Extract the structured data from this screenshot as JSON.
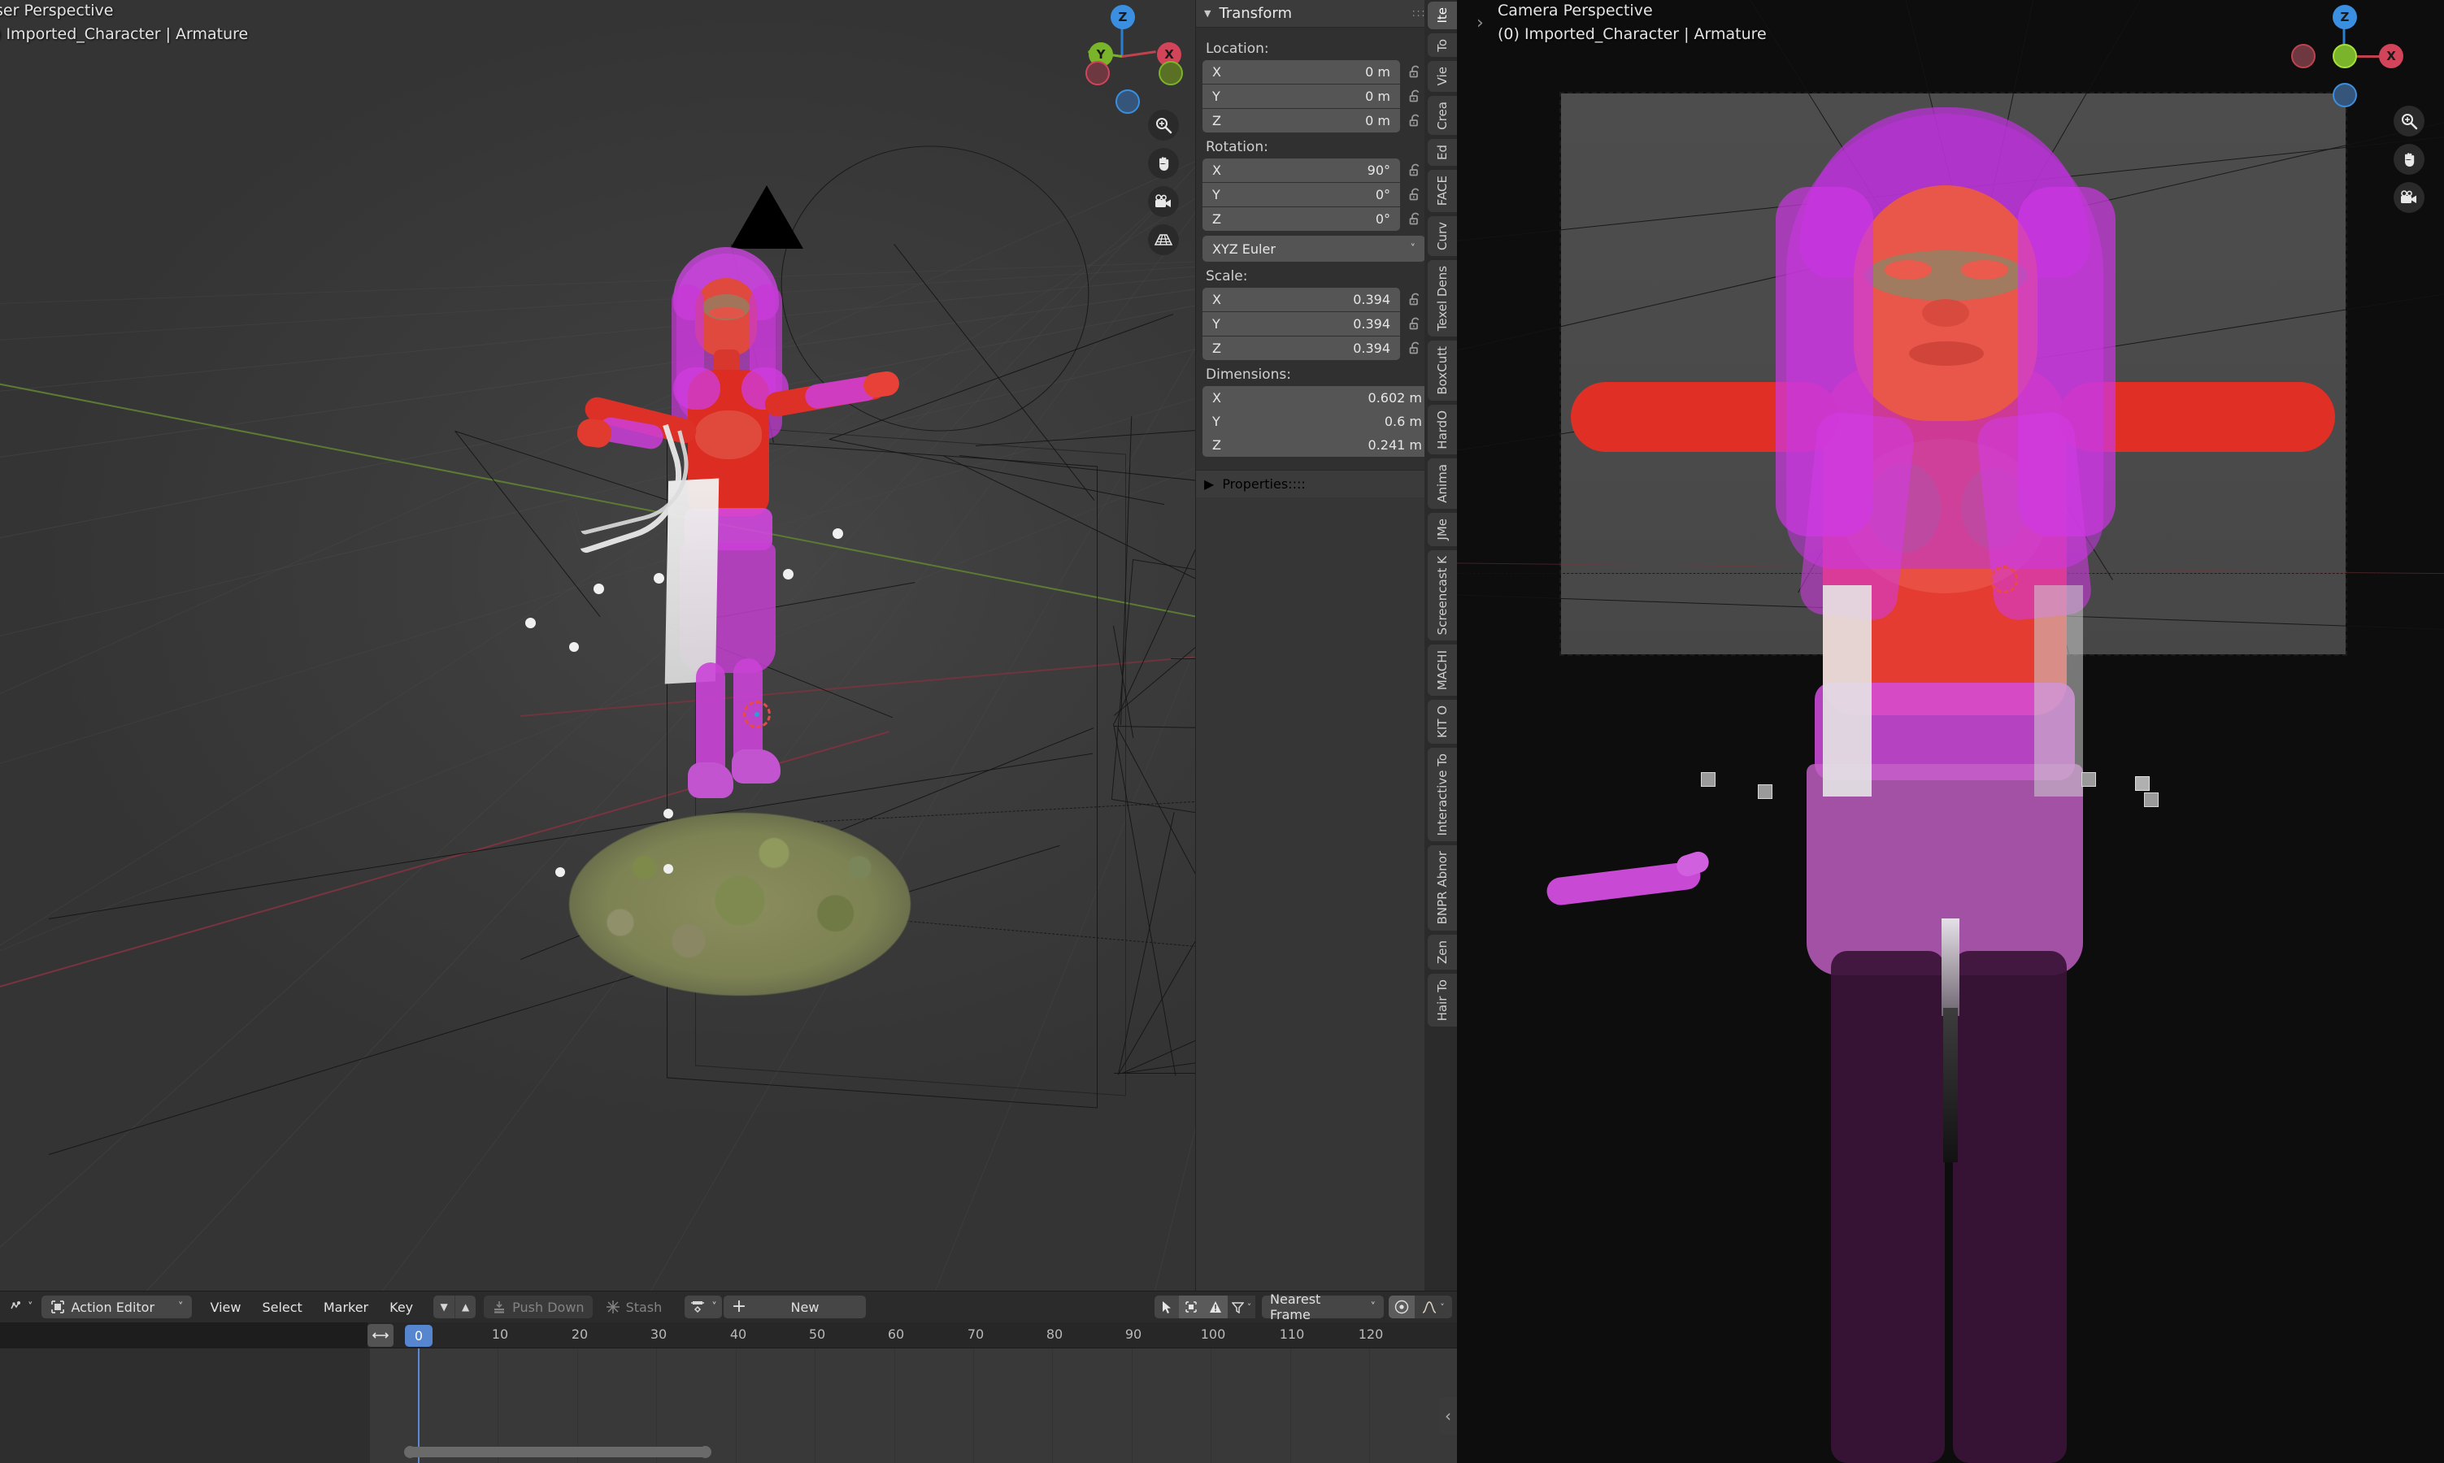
{
  "app": "blender",
  "left_viewport": {
    "name": "3d-viewport-user-perspective",
    "perspective_label": "ser Perspective",
    "object_label": ") Imported_Character | Armature",
    "gizmo": {
      "z": "Z",
      "y": "Y",
      "x": "X"
    },
    "side_buttons": [
      "zoom-icon",
      "pan-hand-icon",
      "camera-icon",
      "grid-perspective-icon"
    ]
  },
  "right_viewport": {
    "name": "3d-viewport-camera-perspective",
    "perspective_label": "Camera Perspective",
    "object_label": "(0) Imported_Character | Armature",
    "gizmo": {
      "z": "Z",
      "x": "X"
    },
    "side_buttons": [
      "zoom-icon",
      "pan-hand-icon",
      "camera-icon"
    ]
  },
  "npanel": {
    "title": "Transform",
    "properties_title": "Properties",
    "location": {
      "label": "Location:",
      "rows": [
        {
          "axis": "X",
          "value": "0 m"
        },
        {
          "axis": "Y",
          "value": "0 m"
        },
        {
          "axis": "Z",
          "value": "0 m"
        }
      ]
    },
    "rotation": {
      "label": "Rotation:",
      "rows": [
        {
          "axis": "X",
          "value": "90°"
        },
        {
          "axis": "Y",
          "value": "0°"
        },
        {
          "axis": "Z",
          "value": "0°"
        }
      ],
      "mode": "XYZ Euler"
    },
    "scale": {
      "label": "Scale:",
      "rows": [
        {
          "axis": "X",
          "value": "0.394"
        },
        {
          "axis": "Y",
          "value": "0.394"
        },
        {
          "axis": "Z",
          "value": "0.394"
        }
      ]
    },
    "dimensions": {
      "label": "Dimensions:",
      "rows": [
        {
          "axis": "X",
          "value": "0.602 m"
        },
        {
          "axis": "Y",
          "value": "0.6 m"
        },
        {
          "axis": "Z",
          "value": "0.241 m"
        }
      ]
    }
  },
  "vertical_tabs": [
    {
      "label": "Ite",
      "active": true
    },
    {
      "label": "To",
      "active": false
    },
    {
      "label": "Vie",
      "active": false
    },
    {
      "label": "Crea",
      "active": false
    },
    {
      "label": "Ed",
      "active": false
    },
    {
      "label": "FACE",
      "active": false
    },
    {
      "label": "Curv",
      "active": false
    },
    {
      "label": "Texel Dens",
      "active": false
    },
    {
      "label": "BoxCutt",
      "active": false
    },
    {
      "label": "HardO",
      "active": false
    },
    {
      "label": "Anima",
      "active": false
    },
    {
      "label": "JMe",
      "active": false
    },
    {
      "label": "Screencast K",
      "active": false
    },
    {
      "label": "MACHI",
      "active": false
    },
    {
      "label": "KIT O",
      "active": false
    },
    {
      "label": "Interactive To",
      "active": false
    },
    {
      "label": "BNPR Abnor",
      "active": false
    },
    {
      "label": "Zen",
      "active": false
    },
    {
      "label": "Hair To",
      "active": false
    }
  ],
  "dopesheet": {
    "editor_type_icon": "editor-type-icon",
    "mode": "Action Editor",
    "menus": [
      "View",
      "Select",
      "Marker",
      "Key"
    ],
    "push_down": "Push Down",
    "stash": "Stash",
    "new_action": "New",
    "snap_mode": "Nearest Frame",
    "proportional_icon": "proportional-edit-icon",
    "falloff_icon": "falloff-curve-icon",
    "filter_icon": "filter-funnel-icon",
    "current_frame": "0",
    "ticks": [
      "0",
      "10",
      "20",
      "30",
      "40",
      "50",
      "60",
      "70",
      "80",
      "90",
      "100",
      "110",
      "120"
    ]
  },
  "colors": {
    "accent_blue": "#5786d1",
    "panel_bg": "#303030",
    "field_bg": "#555555",
    "header_bg": "#2b2b2b",
    "viewport_bg": "#3c3c3c",
    "camera_bg": "#0d0d0d",
    "axis_x_red": "#c1424f",
    "axis_y_green": "#7ab227",
    "axis_z_blue": "#2a7fd4",
    "skin_red": "#e03028",
    "cloth_magenta": "#c93fd4"
  }
}
